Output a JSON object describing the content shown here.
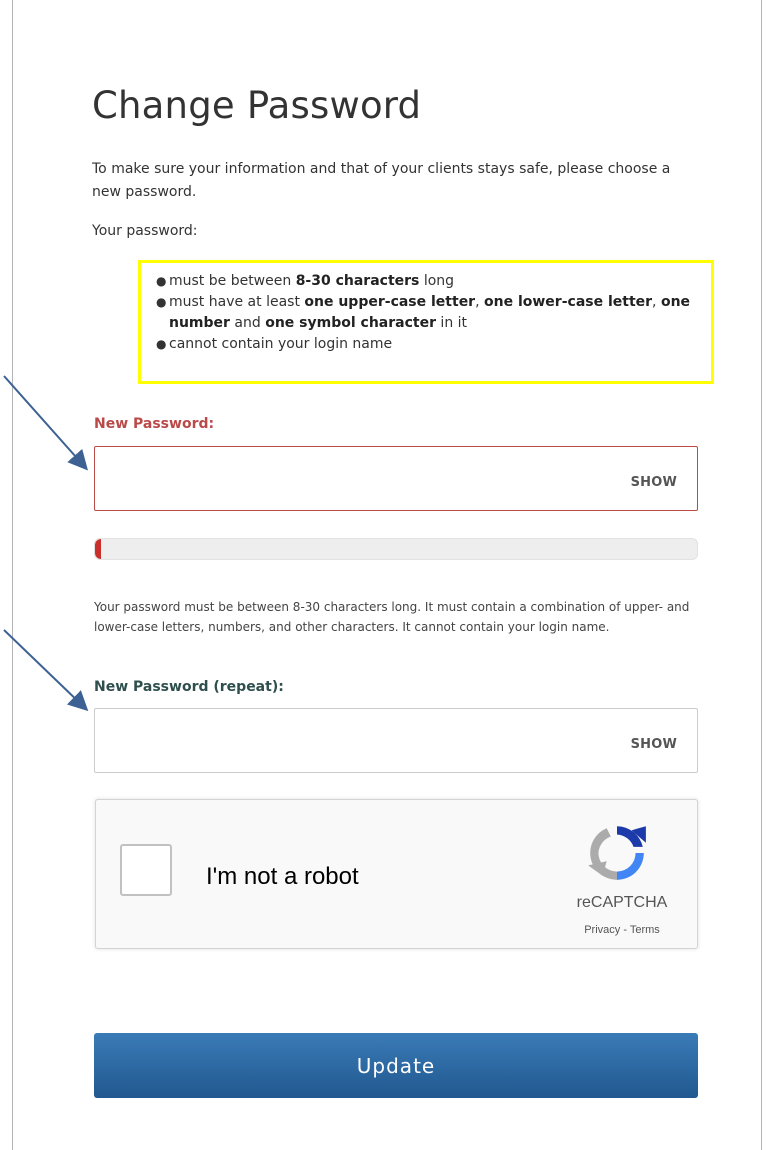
{
  "page": {
    "title": "Change Password",
    "intro": "To make sure your information and that of your clients stays safe, please choose a new password.",
    "your_password_label": "Your password:"
  },
  "rules": {
    "rule1": {
      "pre": "must be between ",
      "bold": "8-30 characters",
      "post": " long"
    },
    "rule2": {
      "pre": "must have at least ",
      "b1": "one upper-case letter",
      "s1": ", ",
      "b2": "one lower-case letter",
      "s2": ", ",
      "b3": "one number",
      "s3": " and ",
      "b4": "one symbol character",
      "post": " in it"
    },
    "rule3": {
      "text": "cannot contain your login name"
    },
    "highlight_color": "#ffff00"
  },
  "new_password": {
    "label": "New Password:",
    "value": "",
    "show_label": "SHOW",
    "state": "error",
    "error_color": "#b94a48"
  },
  "strength": {
    "level": 0.01,
    "color": "#c9302c"
  },
  "hint": "Your password must be between 8-30 characters long. It must contain a combination of upper- and lower-case letters, numbers, and other characters. It cannot contain your login name.",
  "repeat_password": {
    "label": "New Password (repeat):",
    "value": "",
    "show_label": "SHOW"
  },
  "recaptcha": {
    "label": "I'm not a robot",
    "brand": "reCAPTCHA",
    "privacy": "Privacy",
    "separator": " - ",
    "terms": "Terms",
    "checked": false
  },
  "actions": {
    "update_label": "Update",
    "button_color": "#2c6aa6"
  },
  "annotations": {
    "arrow_color": "#3c6192"
  }
}
